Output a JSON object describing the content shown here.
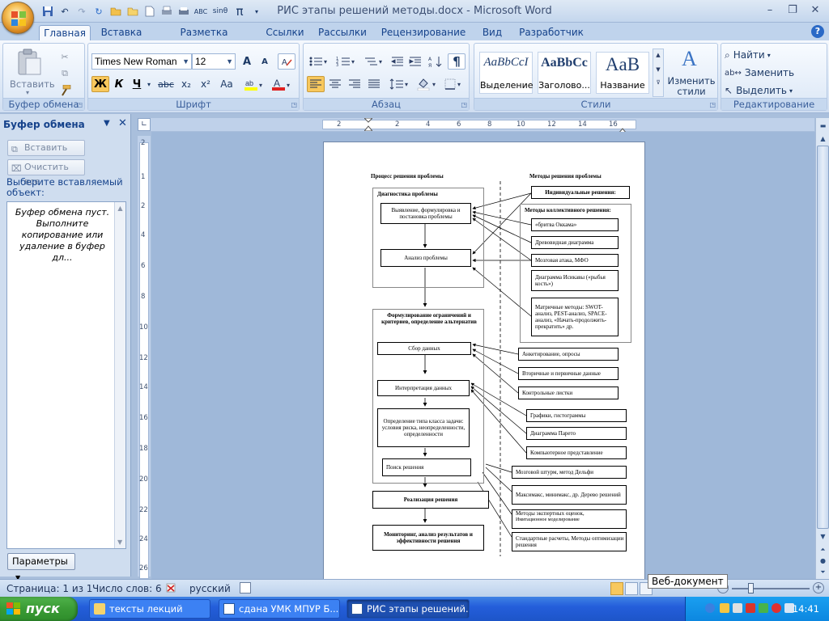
{
  "app": {
    "window_title": "РИС этапы  решений методы.docx - Microsoft Word",
    "help": "?"
  },
  "tabs": [
    "Главная",
    "Вставка",
    "Разметка страницы",
    "Ссылки",
    "Рассылки",
    "Рецензирование",
    "Вид",
    "Разработчик"
  ],
  "ribbon": {
    "clipboard": {
      "label": "Буфер обмена",
      "paste": "Вставить"
    },
    "font": {
      "label": "Шрифт",
      "font_name": "Times New Roman",
      "font_size": "12",
      "bold": "Ж",
      "italic": "К",
      "underline": "Ч",
      "strike": "abc",
      "subscript": "x₂",
      "superscript": "x²",
      "case": "Аа",
      "grow": "A",
      "shrink": "A"
    },
    "paragraph": {
      "label": "Абзац"
    },
    "styles": {
      "label": "Стили",
      "items": [
        {
          "sample": "AaBbCcI",
          "name": "Выделение"
        },
        {
          "sample": "AaBbCc",
          "name": "Заголово..."
        },
        {
          "sample": "AaB",
          "name": "Название"
        }
      ],
      "change": "Изменить стили"
    },
    "editing": {
      "label": "Редактирование",
      "find": "Найти",
      "replace": "Заменить",
      "select": "Выделить"
    }
  },
  "pane": {
    "title": "Буфер обмена",
    "paste_all": "Вставить все",
    "clear_all": "Очистить все",
    "hint": "Выберите вставляемый объект:",
    "empty": "Буфер обмена пуст. Выполните копирование или удаление в буфер дл...",
    "params": "Параметры"
  },
  "ruler": {
    "h": [
      "2",
      "2",
      "4",
      "6",
      "8",
      "10",
      "12",
      "14",
      "16"
    ],
    "v": [
      "2",
      "1",
      "2",
      "4",
      "6",
      "8",
      "10",
      "12",
      "14",
      "16",
      "18",
      "20",
      "22",
      "24",
      "26"
    ]
  },
  "diagram": {
    "header_left": "Процесс решения проблемы",
    "header_right": "Методы решения проблемы",
    "diag_title": "Диагностика проблемы",
    "step1": "Выявление, формулировка и постановка проблемы",
    "step2": "Анализ проблемы",
    "formul_title": "Формулирование ограничений и критериев, определение альтернатив",
    "step3": "Сбор данных",
    "step4": "Интерпретация данных",
    "step5": "Определение типа класса задачи: условия риска, неопределенности, определенности",
    "step6": "Поиск решения",
    "step7": "Реализация решения",
    "step8": "Мониторинг, анализ результатов и эффективности решения",
    "m_individual": "Индивидуальные решения:",
    "m_collective": "Методы коллективного решения:",
    "m1": "«бритва Оккама»",
    "m2": "Древовидная диаграмма",
    "m3": "Мозговая атака,  МФО",
    "m4": "Диаграмма  Исикавы («рыбья кость»)",
    "m5": "Матричные методы: SWOT-анализ, PEST-анализ, SPACE-анализ, «Начать-продолжить-прекратить» др.",
    "d1": "Анкетирование, опросы",
    "d2": "Вторичные и первичные данные",
    "d3": "Контрольные листки",
    "i1": "Графики, гистограммы",
    "i2": "Диаграмма Парето",
    "i3": "Компьютерное представление",
    "s1": "Мозговой штурм, метод Дельфи",
    "s2": "Максимакс, минимакс, др. Дерево решений",
    "s3a": "Методы экспертных оценок,",
    "s3b": "Имитационное моделирование",
    "s4": "Стандартные расчеты, Методы оптимизации решения"
  },
  "status": {
    "page": "Страница: 1 из 1",
    "words": "Число слов: 6",
    "lang": "русский",
    "tooltip": "Веб-документ"
  },
  "taskbar": {
    "start": "пуск",
    "tasks": [
      "тексты лекций",
      "сдана УМК  МПУР  Б...",
      "РИС этапы  решений..."
    ],
    "lang": "RL",
    "clock": "14:41"
  }
}
